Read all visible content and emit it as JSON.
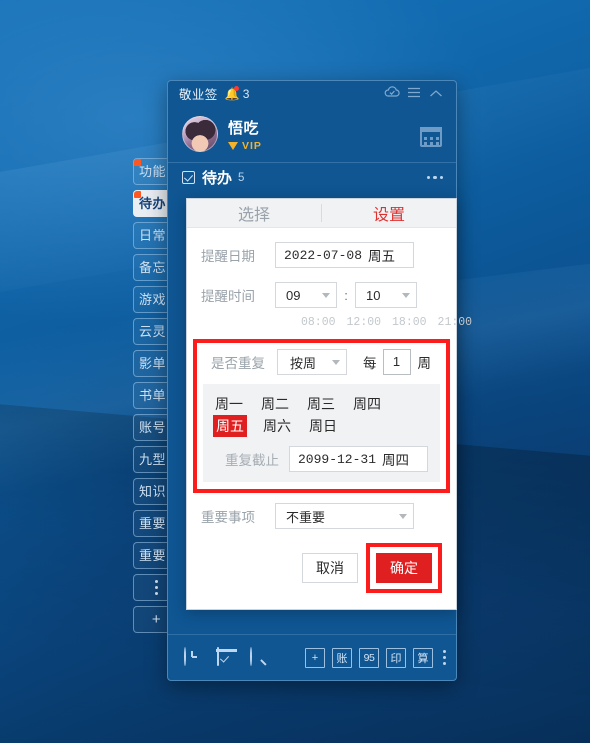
{
  "desktop": {
    "wallpaper_color": "#0d5596"
  },
  "side_tabs": [
    {
      "label": "功能",
      "active": false,
      "dot": true,
      "type": "text"
    },
    {
      "label": "待办",
      "active": true,
      "dot": true,
      "type": "text"
    },
    {
      "label": "日常",
      "active": false,
      "dot": false,
      "type": "text"
    },
    {
      "label": "备忘",
      "active": false,
      "dot": false,
      "type": "text"
    },
    {
      "label": "游戏",
      "active": false,
      "dot": false,
      "type": "text"
    },
    {
      "label": "云灵",
      "active": false,
      "dot": false,
      "type": "text"
    },
    {
      "label": "影单",
      "active": false,
      "dot": false,
      "type": "text"
    },
    {
      "label": "书单",
      "active": false,
      "dot": false,
      "type": "text"
    },
    {
      "label": "账号",
      "active": false,
      "dot": false,
      "type": "text"
    },
    {
      "label": "九型",
      "active": false,
      "dot": false,
      "type": "text"
    },
    {
      "label": "知识",
      "active": false,
      "dot": false,
      "type": "text"
    },
    {
      "label": "重要",
      "active": false,
      "dot": false,
      "type": "text"
    },
    {
      "label": "重要",
      "active": false,
      "dot": false,
      "type": "text"
    },
    {
      "label": "",
      "active": false,
      "dot": false,
      "type": "more"
    },
    {
      "label": "+",
      "active": false,
      "dot": false,
      "type": "add"
    }
  ],
  "window": {
    "title": "敬业签",
    "notification_count": "3",
    "icons": {
      "bell": "bell-icon",
      "cloud": "cloud-sync-icon",
      "menu": "hamburger-menu-icon",
      "collapse": "chevron-up-icon"
    }
  },
  "profile": {
    "nickname": "悟吃",
    "vip_label": "VIP",
    "avatar": "user-avatar",
    "calendar_icon": "calendar-icon"
  },
  "list_header": {
    "title": "待办",
    "count": "5",
    "check_icon": "checkbox-calendar-icon",
    "more_icon": "more-horizontal-icon"
  },
  "dialog": {
    "tabs": [
      {
        "label": "选择",
        "active": false
      },
      {
        "label": "设置",
        "active": true
      }
    ],
    "reminder_date": {
      "label": "提醒日期",
      "value": "2022-07-08",
      "weekday": "周五"
    },
    "reminder_time": {
      "label": "提醒时间",
      "hour": "09",
      "minute": "10",
      "separator": ":",
      "presets": [
        "08:00",
        "12:00",
        "18:00",
        "21:00"
      ]
    },
    "repeat": {
      "label": "是否重复",
      "mode": "按周",
      "every_prefix": "每",
      "every_value": "1",
      "unit_suffix": "周",
      "weekdays": [
        {
          "label": "周一",
          "selected": false
        },
        {
          "label": "周二",
          "selected": false
        },
        {
          "label": "周三",
          "selected": false
        },
        {
          "label": "周四",
          "selected": false
        },
        {
          "label": "周五",
          "selected": true
        },
        {
          "label": "周六",
          "selected": false
        },
        {
          "label": "周日",
          "selected": false
        }
      ],
      "until_label": "重复截止",
      "until_value": "2099-12-31",
      "until_weekday": "周四",
      "highlight_color": "#fc1c1c"
    },
    "importance": {
      "label": "重要事项",
      "value": "不重要"
    },
    "footer": {
      "cancel_label": "取消",
      "confirm_label": "确定",
      "confirm_color": "#e02020",
      "highlight_color": "#fc1c1c"
    }
  },
  "bottom_bar": {
    "left_icons": [
      "clock-icon",
      "task-icon",
      "search-icon"
    ],
    "right_buttons": [
      "+",
      "账",
      "95",
      "印",
      "算"
    ],
    "overflow_icon": "more-vertical-icon"
  }
}
